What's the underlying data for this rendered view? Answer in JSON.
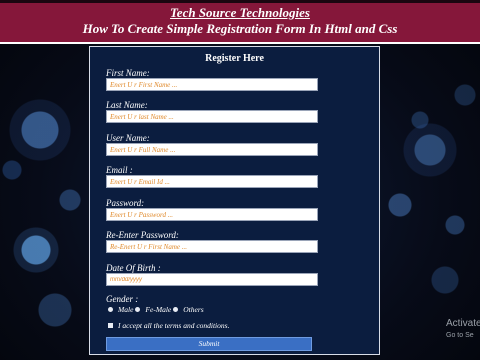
{
  "header": {
    "title": "Tech Source Technologies",
    "subtitle": "How To Create Simple Registration Form In Html and Css"
  },
  "form": {
    "title": "Register Here",
    "fields": [
      {
        "label": "First Name:",
        "placeholder": "Enert U r First Name ..."
      },
      {
        "label": "Last Name:",
        "placeholder": "Enert U r last Name ..."
      },
      {
        "label": "User Name:",
        "placeholder": "Enert U r Full Name ..."
      },
      {
        "label": "Email :",
        "placeholder": "Enert U r Email Id ..."
      },
      {
        "label": "Password:",
        "placeholder": "Enert U r Password ..."
      },
      {
        "label": "Re-Enter Password:",
        "placeholder": "Re-Enert U r First Name ..."
      },
      {
        "label": "Date Of Birth :",
        "placeholder": "mm/dd/yyyy"
      }
    ],
    "gender": {
      "label": "Gender :",
      "options": [
        "Male",
        "Fe-Male",
        "Others"
      ]
    },
    "terms_label": "I accept all the terms and conditions.",
    "submit_label": "Submit"
  },
  "watermark": {
    "line1": "Activate",
    "line2": "Go to Se"
  },
  "colors": {
    "header_bg": "#85173a",
    "form_bg": "#0b1d3f",
    "placeholder": "#e08a2c",
    "submit_bg": "#3a6fc4"
  }
}
